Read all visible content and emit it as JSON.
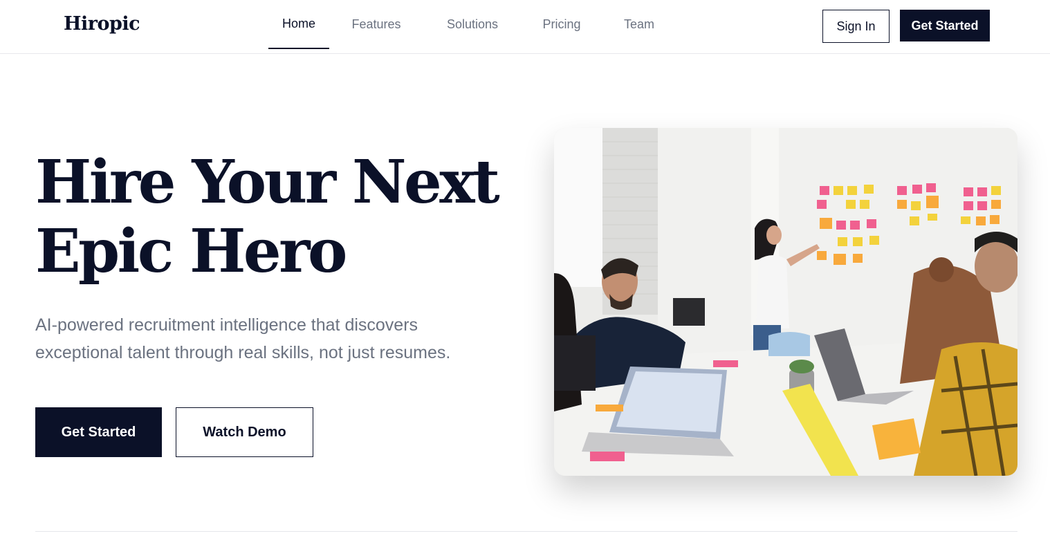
{
  "brand": {
    "name": "Hiropic",
    "accent_color": "#0b1128"
  },
  "nav": {
    "items": [
      {
        "label": "Home",
        "active": true
      },
      {
        "label": "Features",
        "active": false
      },
      {
        "label": "Solutions",
        "active": false
      },
      {
        "label": "Pricing",
        "active": false
      },
      {
        "label": "Team",
        "active": false
      }
    ]
  },
  "header_actions": {
    "sign_in": "Sign In",
    "get_started": "Get Started"
  },
  "hero": {
    "title_line_1": "Hire Your Next",
    "title_line_2": "Epic Hero",
    "subtitle": "AI-powered recruitment intelligence that discovers exceptional talent through real skills, not just resumes.",
    "primary_cta": "Get Started",
    "secondary_cta": "Watch Demo",
    "image_subject": "team meeting with a woman presenting sticky notes on a wall"
  }
}
